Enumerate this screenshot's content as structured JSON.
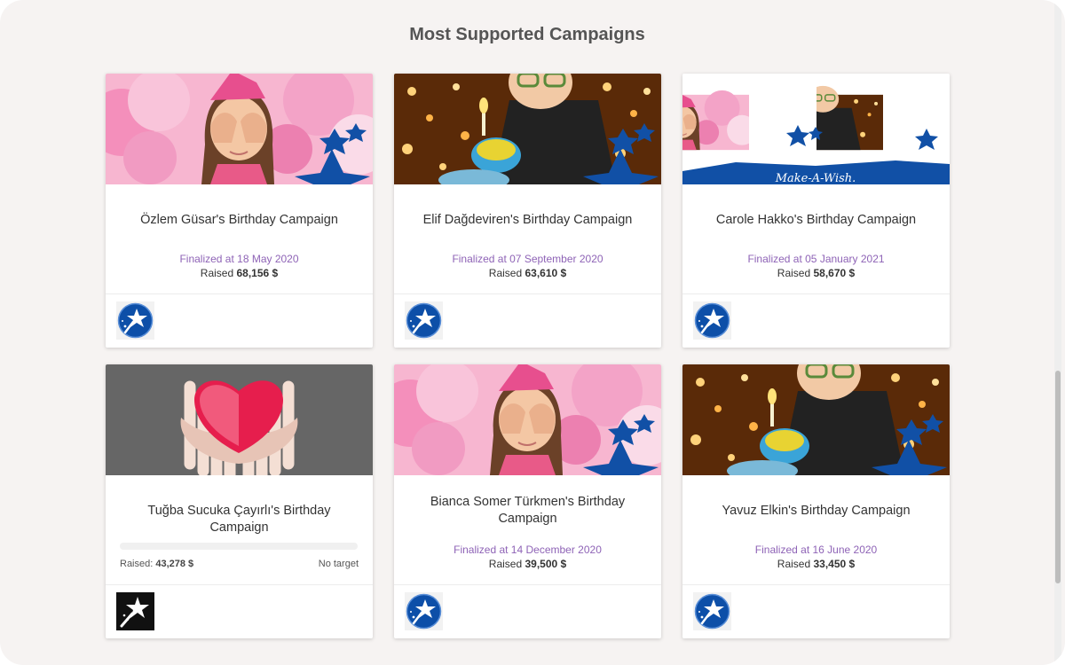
{
  "page": {
    "title": "Most Supported Campaigns"
  },
  "campaigns": [
    {
      "title": "Özlem Güsar's Birthday Campaign",
      "date": "Finalized at 18 May 2020",
      "raised_label": "Raised",
      "raised_value": "68,156 $",
      "image": "girl-covering-eyes-balloons",
      "logo": "make-a-wish-star-icon"
    },
    {
      "title": "Elif Dağdeviren's Birthday Campaign",
      "date": "Finalized at 07 September 2020",
      "raised_label": "Raised",
      "raised_value": "63,610 $",
      "image": "boy-blowing-candle-cake",
      "logo": "make-a-wish-star-icon"
    },
    {
      "title": "Carole Hakko's Birthday Campaign",
      "date": "Finalized at 05 January 2021",
      "raised_label": "Raised",
      "raised_value": "58,670 $",
      "image": "make-a-wish-collage",
      "banner_text": "Make-A-Wish.",
      "logo": "make-a-wish-star-icon"
    },
    {
      "title": "Tuğba Sucuka Çayırlı's Birthday Campaign",
      "raised_label": "Raised:",
      "raised_value": "43,278 $",
      "target_text": "No target",
      "progress": 0,
      "image": "hands-holding-heart",
      "logo": "black-wand-star-icon"
    },
    {
      "title": "Bianca Somer Türkmen's Birthday Campaign",
      "date": "Finalized at 14 December 2020",
      "raised_label": "Raised",
      "raised_value": "39,500 $",
      "image": "girl-covering-eyes-balloons",
      "logo": "make-a-wish-star-icon"
    },
    {
      "title": "Yavuz Elkin's Birthday Campaign",
      "date": "Finalized at 16 June 2020",
      "raised_label": "Raised",
      "raised_value": "33,450 $",
      "image": "boy-blowing-candle-cake",
      "logo": "make-a-wish-star-icon"
    }
  ],
  "colors": {
    "accent_purple": "#8e63b6",
    "brand_blue": "#1150a6",
    "background": "#f6f3f2"
  }
}
